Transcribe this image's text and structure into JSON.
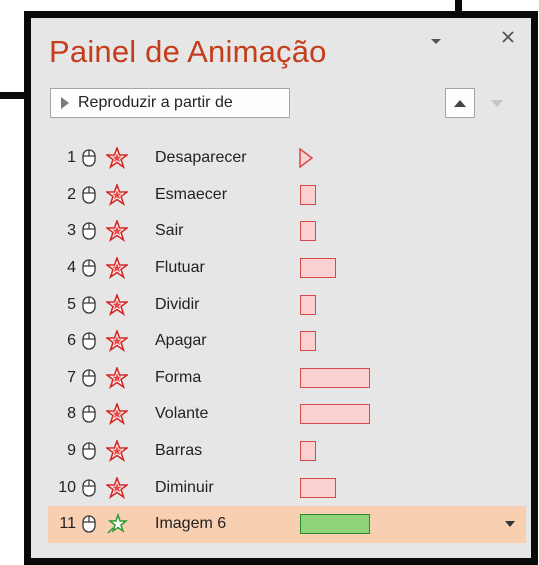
{
  "panel": {
    "title": "Painel de Animação",
    "play_label": "Reproduzir a partir de"
  },
  "icons": {
    "dropdown": "chevron-down-icon",
    "close": "close-icon",
    "move_up": "triangle-up-icon",
    "move_down": "triangle-down-icon",
    "mouse": "mouse-click-icon",
    "exit_effect": "star-burst-icon",
    "entrance_effect": "green-star-icon"
  },
  "colors": {
    "title": "#c43e1c",
    "exit_bar_fill": "#fbd0d0",
    "exit_bar_border": "#d44a4a",
    "entrance_bar_fill": "#8fd47a",
    "selected_row": "#f8cfb0"
  },
  "animations": [
    {
      "number": "1",
      "name": "Desaparecer",
      "effect": "exit",
      "timing": "marker"
    },
    {
      "number": "2",
      "name": "Esmaecer",
      "effect": "exit",
      "timing": "short"
    },
    {
      "number": "3",
      "name": "Sair",
      "effect": "exit",
      "timing": "short"
    },
    {
      "number": "4",
      "name": "Flutuar",
      "effect": "exit",
      "timing": "medium"
    },
    {
      "number": "5",
      "name": "Dividir",
      "effect": "exit",
      "timing": "short"
    },
    {
      "number": "6",
      "name": "Apagar",
      "effect": "exit",
      "timing": "short"
    },
    {
      "number": "7",
      "name": "Forma",
      "effect": "exit",
      "timing": "long"
    },
    {
      "number": "8",
      "name": "Volante",
      "effect": "exit",
      "timing": "long"
    },
    {
      "number": "9",
      "name": "Barras",
      "effect": "exit",
      "timing": "short"
    },
    {
      "number": "10",
      "name": "Diminuir",
      "effect": "exit",
      "timing": "medium"
    },
    {
      "number": "11",
      "name": "Imagem 6",
      "effect": "entrance",
      "timing": "long",
      "selected": true
    }
  ]
}
